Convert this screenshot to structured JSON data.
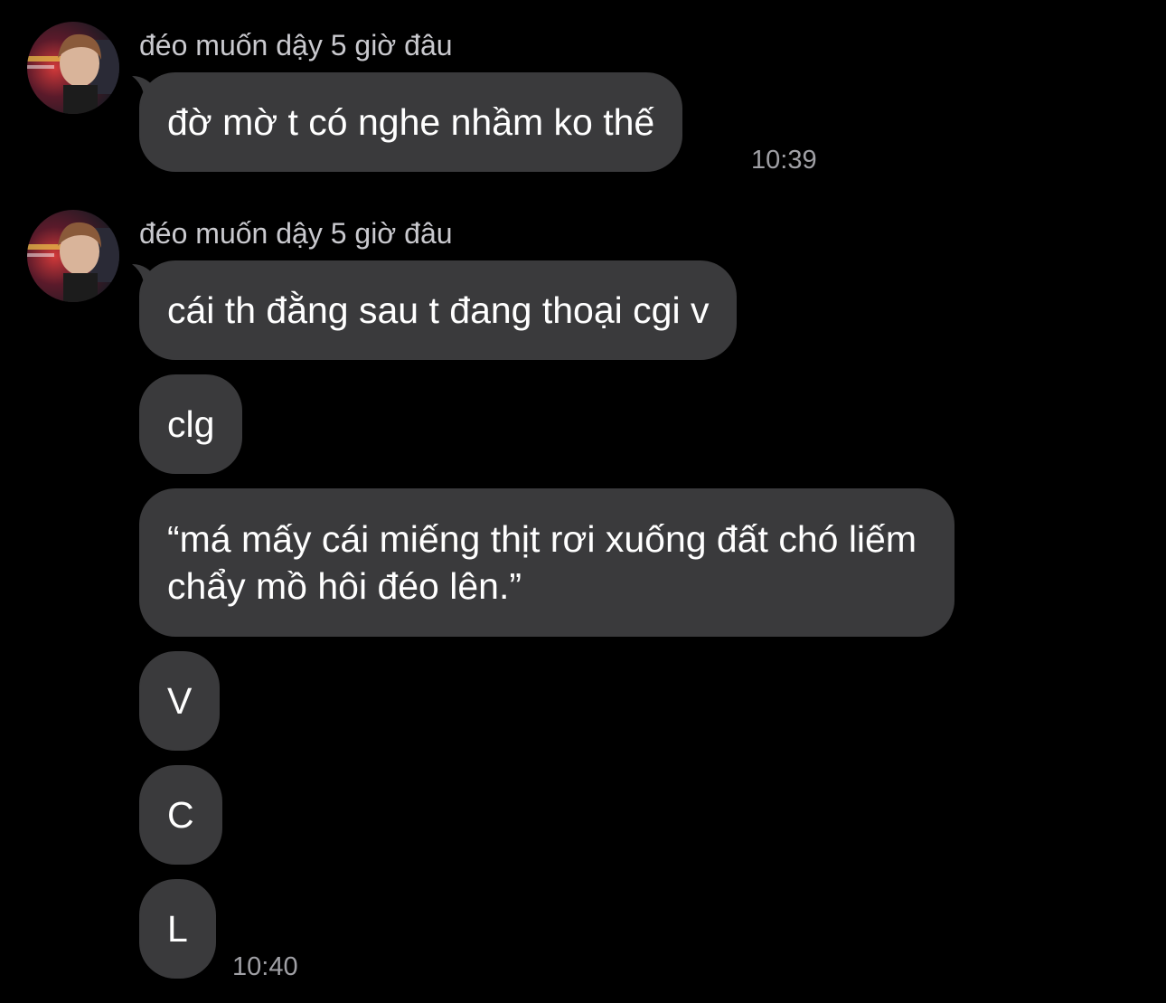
{
  "messages": [
    {
      "sender": "đéo muốn dậy 5 giờ đâu",
      "bubbles": [
        "đờ mờ t có nghe nhầm ko thế"
      ],
      "time": "10:39"
    },
    {
      "sender": "đéo muốn dậy 5 giờ đâu",
      "bubbles": [
        "cái th đằng sau t đang thoại cgi v",
        "clg",
        "“má mấy cái miếng thịt rơi xuống đất chó liếm chẩy mồ hôi đéo lên.”",
        "V",
        "C",
        "L"
      ],
      "time": "10:40"
    }
  ],
  "colors": {
    "background": "#000000",
    "bubble": "#3a3a3c",
    "text": "#ffffff",
    "sender": "#c9c9ce",
    "time": "#a0a0a5"
  },
  "icons": {
    "avatar": "user-avatar-photo"
  }
}
